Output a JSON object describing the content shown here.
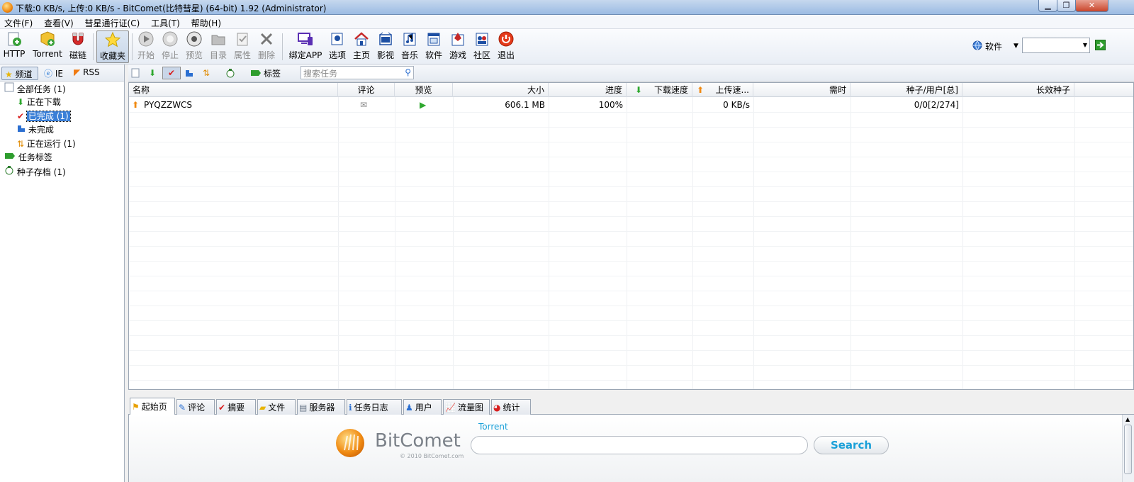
{
  "window": {
    "title": "下载:0 KB/s, 上传:0 KB/s - BitComet(比特彗星) (64-bit) 1.92 (Administrator)",
    "minimize": "▁",
    "restore": "❐",
    "close": "✕"
  },
  "menu": [
    "文件(F)",
    "查看(V)",
    "彗星通行证(C)",
    "工具(T)",
    "帮助(H)"
  ],
  "toolbar": {
    "http": "HTTP",
    "torrent": "Torrent",
    "magnet": "磁链",
    "favorites": "收藏夹",
    "start": "开始",
    "stop": "停止",
    "preview": "预览",
    "directory": "目录",
    "properties": "属性",
    "delete": "删除",
    "bind_app": "绑定APP",
    "options": "选项",
    "home": "主页",
    "video": "影视",
    "music": "音乐",
    "software": "软件",
    "games": "游戏",
    "community": "社区",
    "exit": "退出",
    "search_category": "软件",
    "search_input_value": ""
  },
  "left_tabs": [
    "频道",
    "IE",
    "RSS"
  ],
  "tree": {
    "all_tasks": "全部任务 (1)",
    "downloading": "正在下载",
    "completed": "已完成 (1)",
    "incomplete": "未完成",
    "running": "正在运行 (1)",
    "task_labels": "任务标签",
    "torrent_archive": "种子存档 (1)"
  },
  "subtoolbar": {
    "label": "标签",
    "search_placeholder": "搜索任务"
  },
  "columns": [
    "名称",
    "评论",
    "预览",
    "大小",
    "进度",
    "下载速度",
    "上传速...",
    "需时",
    "种子/用户[总]",
    "长效种子"
  ],
  "tasks": [
    {
      "name": "PYQZZWCS",
      "size": "606.1 MB",
      "progress": "100%",
      "download_speed": "",
      "upload_speed": "0 KB/s",
      "eta": "",
      "seeds_peers": "0/0[2/274]",
      "long_seeds": ""
    }
  ],
  "bottom_tabs": [
    "起始页",
    "评论",
    "摘要",
    "文件",
    "服务器",
    "任务日志",
    "用户",
    "流量图",
    "统计"
  ],
  "start_page": {
    "brand": "BitComet",
    "copyright": "© 2010 BitComet.com",
    "torrent_label": "Torrent",
    "search_button": "Search"
  },
  "colors": {
    "accent": "#3a7fd7",
    "brand_orange": "#f08a12",
    "search_button_text": "#1aa0d8"
  }
}
